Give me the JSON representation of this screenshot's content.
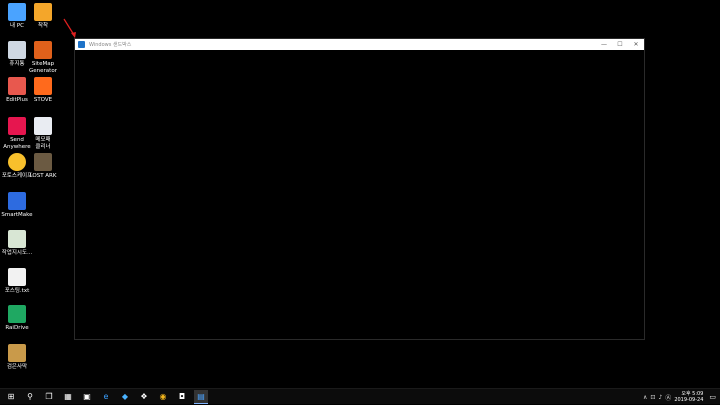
{
  "desktop": {
    "icons": [
      {
        "label": "내 PC",
        "color": "#4aa3ff"
      },
      {
        "label": "착착",
        "color": "#f4a62a"
      },
      {
        "label": "휴지통",
        "color": "#cfd8e3"
      },
      {
        "label": "SiteMap\nGenerator",
        "color": "#e0611b"
      },
      {
        "label": "EditPlus",
        "color": "#e8584e"
      },
      {
        "label": "STOVE",
        "color": "#ff6a1c"
      },
      {
        "label": "Send\nAnywhere",
        "color": "#e6164f"
      },
      {
        "label": "메모패\n클리너",
        "color": "#e9ecf2"
      },
      {
        "label": "포토스케이프",
        "color": "#f8c02c"
      },
      {
        "label": "LOST ARK",
        "color": "#6b5a42"
      },
      {
        "label": "SmartMake",
        "color": "#2d6be0"
      },
      {
        "label": "작업지시도...",
        "color": "#d8e6d4"
      },
      {
        "label": "포스팅.txt",
        "color": "#f2f2f2"
      },
      {
        "label": "RaiDrive",
        "color": "#1fa862"
      },
      {
        "label": "검은사막",
        "color": "#c99a4a"
      }
    ]
  },
  "window": {
    "title": "Windows 샌드박스",
    "minimize": "—",
    "maximize": "☐",
    "close": "✕"
  },
  "taskbar": {
    "start": "⊞",
    "search": "⚲",
    "taskview": "❐",
    "apps": [
      "▦",
      "▣",
      "e",
      "◆",
      "❖",
      "◉",
      "◘",
      "▤"
    ],
    "tray_icons": [
      "∧",
      "⊡",
      "♪",
      "Ⓐ"
    ],
    "time": "오후 5:09",
    "date": "2019-09-24",
    "notification": "▭"
  }
}
